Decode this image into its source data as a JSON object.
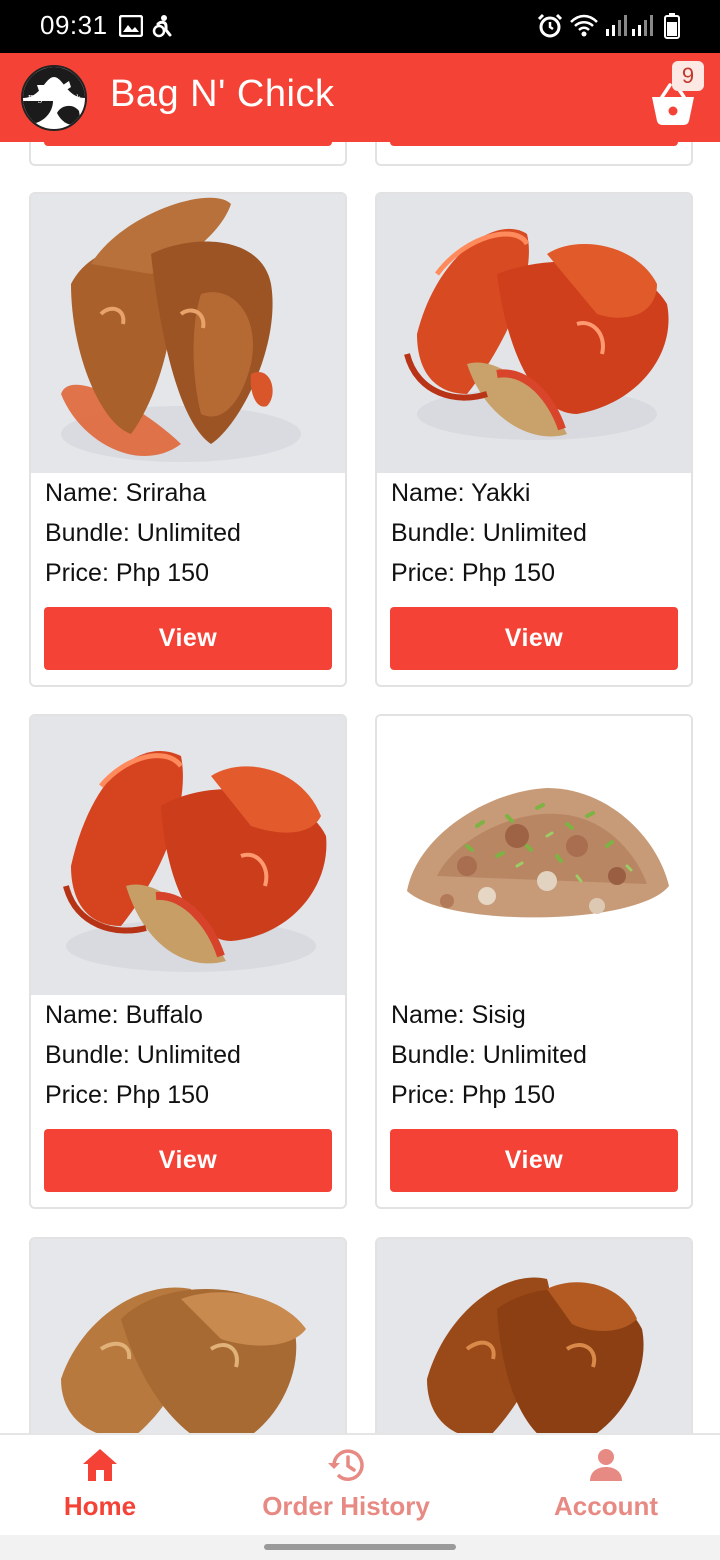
{
  "status_bar": {
    "time": "09:31",
    "icons": [
      "image-icon",
      "accessibility-icon",
      "alarm-icon",
      "wifi-icon",
      "signal-icon",
      "signal-icon",
      "battery-icon"
    ]
  },
  "app_bar": {
    "title": "Bag N' Chick",
    "logo_text": "Bag N' Chick",
    "cart_count": "9",
    "color": "#f44336"
  },
  "products": [
    {
      "name": "Name: Sriraha",
      "bundle": "Bundle: Unlimited",
      "price": "Price: Php 150",
      "button": "View",
      "image": "sriracha-wings"
    },
    {
      "name": "Name: Yakki",
      "bundle": "Bundle: Unlimited",
      "price": "Price: Php 150",
      "button": "View",
      "image": "glazed-wings"
    },
    {
      "name": "Name: Buffalo",
      "bundle": "Bundle: Unlimited",
      "price": "Price: Php 150",
      "button": "View",
      "image": "buffalo-wings"
    },
    {
      "name": "Name: Sisig",
      "bundle": "Bundle: Unlimited",
      "price": "Price: Php 150",
      "button": "View",
      "image": "sisig"
    }
  ],
  "bottom_nav": {
    "items": [
      {
        "label": "Home",
        "icon": "home-icon",
        "active": true
      },
      {
        "label": "Order History",
        "icon": "history-icon",
        "active": false
      },
      {
        "label": "Account",
        "icon": "account-icon",
        "active": false
      }
    ],
    "active_color": "#f44336",
    "inactive_color": "#e88a84"
  }
}
